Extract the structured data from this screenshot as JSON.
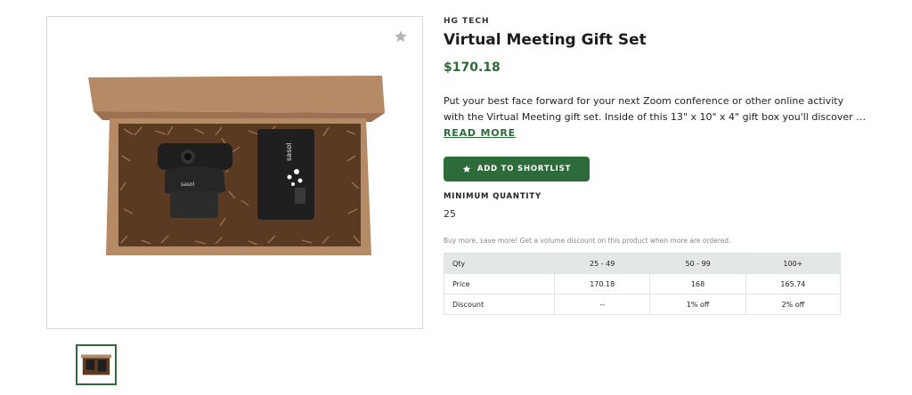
{
  "product": {
    "brand": "HG TECH",
    "title": "Virtual Meeting Gift Set",
    "price": "$170.18",
    "description_lines": [
      "Put your best face forward for your next Zoom conference or other online activity",
      "with the Virtual Meeting gift set. Inside of this 13\" x 10\" x 4\" gift box you'll discover …"
    ],
    "read_more": "READ MORE",
    "shortlist_button": "ADD TO SHORTLIST",
    "min_quantity_label": "MINIMUM QUANTITY",
    "min_quantity_value": "25",
    "discount_note": "Buy more, save more! Get a volume discount on this product when more are ordered."
  },
  "pricing_table": {
    "headers": [
      "Qty",
      "25 - 49",
      "50 - 99",
      "100+"
    ],
    "rows": [
      [
        "Price",
        "170.18",
        "168",
        "165.74"
      ],
      [
        "Discount",
        "--",
        "1% off",
        "2% off"
      ]
    ]
  },
  "image_branding": {
    "device_logo": "sasol"
  },
  "colors": {
    "accent": "#2e6b3b",
    "table_header_bg": "#e3e8e5"
  },
  "icons": {
    "favorite": "star-icon",
    "shortlist": "star-icon"
  }
}
